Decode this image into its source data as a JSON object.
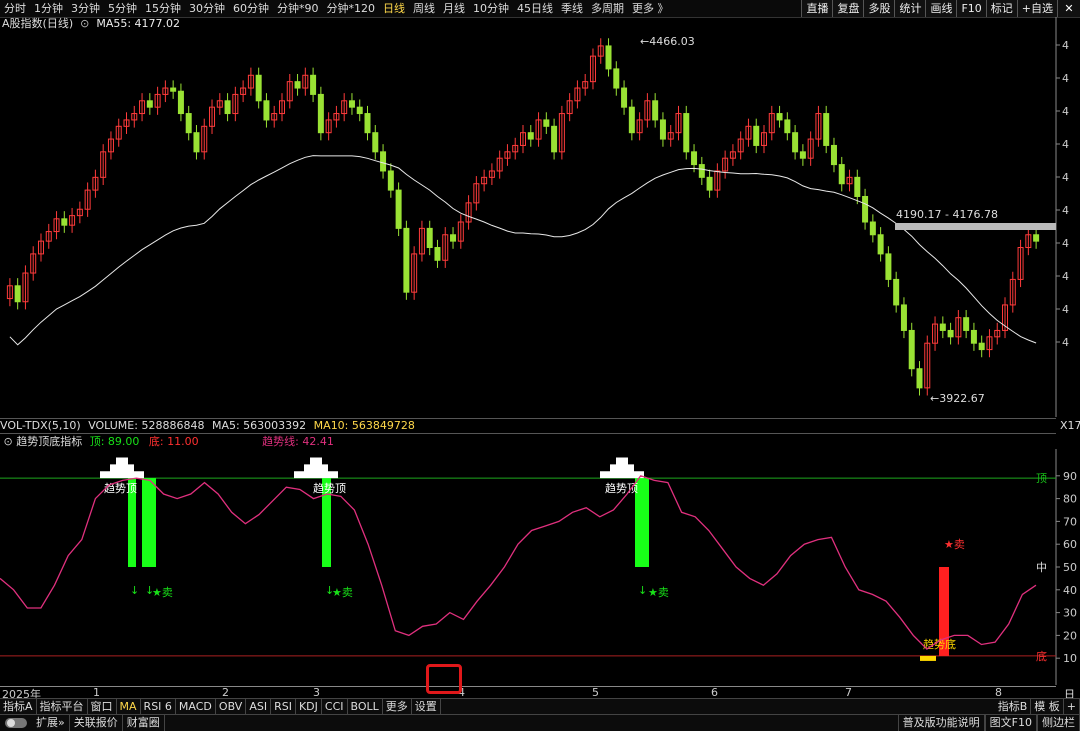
{
  "toolbar": {
    "periods": [
      "分时",
      "1分钟",
      "3分钟",
      "5分钟",
      "15分钟",
      "30分钟",
      "60分钟",
      "分钟*90",
      "分钟*120",
      "日线",
      "周线",
      "月线",
      "10分钟",
      "45日线",
      "季线",
      "多周期",
      "更多 》"
    ],
    "active_period": "日线",
    "right_buttons": [
      "直播",
      "复盘",
      "多股",
      "统计",
      "画线",
      "F10",
      "标记",
      "+自选"
    ],
    "window_controls": [
      "✕"
    ]
  },
  "main_chart": {
    "title": "A股指数(日线)",
    "indicator": "MA55: 4177.02",
    "high_label": "4466.03",
    "low_label": "3922.67",
    "range_label": "4190.17 - 4176.78"
  },
  "volume_header": {
    "name": "VOL-TDX(5,10)",
    "volume": "VOLUME: 528886848",
    "ma5": "MA5: 563003392",
    "ma10": "MA10: 563849728"
  },
  "right_edge_label": "X17",
  "indicator_header": {
    "name": "趋势顶底指标",
    "top": "顶: 89.00",
    "bottom": "底: 11.00",
    "line": "趋势线: 42.41"
  },
  "indicator_labels": {
    "top_marker": "趋势顶",
    "bottom_marker": "趋势底",
    "sell": "卖",
    "right_top": "顶",
    "right_mid": "中",
    "right_bottom": "底"
  },
  "indicator_axis": [
    "90",
    "80",
    "70",
    "60",
    "50",
    "40",
    "30",
    "20",
    "10"
  ],
  "x_axis": {
    "year_label": "2025年",
    "months": [
      "1",
      "2",
      "3",
      "4",
      "5",
      "6",
      "7",
      "8"
    ]
  },
  "x_axis_right": "日",
  "tabs": [
    "指标A",
    "指标平台",
    "窗口",
    "MA",
    "RSI 6",
    "MACD",
    "OBV",
    "ASI",
    "RSI",
    "KDJ",
    "CCI",
    "BOLL",
    "更多",
    "设置"
  ],
  "active_tab": "MA",
  "tabs_right": [
    "指标B",
    "模 板",
    "+"
  ],
  "statusbar": {
    "left": [
      "扩展»",
      "关联报价",
      "财富圈"
    ],
    "right": [
      "普及版功能说明",
      "图文F10",
      "侧边栏"
    ]
  },
  "colors": {
    "up": "#ff3b3b",
    "down": "#9ae234",
    "ma_line": "#e8e8e8",
    "trend_line": "#e0307e",
    "top_bar": "#18ff18",
    "bottom_bar": "#ff2020",
    "guide_line": "#1ea81e",
    "highlight_box": "#e0181a"
  },
  "icons": [
    "close-icon",
    "toggle-icon"
  ],
  "chart_data": {
    "type": "candlestick",
    "title": "A股指数(日线)",
    "annotations": [
      "4466.03",
      "3922.67",
      "4190.17 - 4176.78"
    ],
    "ma55_last": 4177.02,
    "indicator_series": {
      "name": "趋势线",
      "last": 42.41,
      "top_threshold": 89.0,
      "bottom_threshold": 11.0,
      "values": [
        45,
        40,
        32,
        32,
        42,
        55,
        62,
        80,
        86,
        88,
        89,
        88,
        82,
        80,
        82,
        87,
        82,
        74,
        69,
        73,
        79,
        85,
        84,
        80,
        82,
        81,
        75,
        60,
        42,
        22,
        20,
        24,
        25,
        30,
        27,
        35,
        42,
        50,
        60,
        66,
        68,
        70,
        74,
        76,
        72,
        75,
        82,
        90,
        88,
        87,
        74,
        72,
        66,
        58,
        50,
        45,
        42,
        47,
        55,
        60,
        62,
        63,
        50,
        40,
        38,
        35,
        28,
        20,
        14,
        18,
        20,
        20,
        16,
        17,
        25,
        38,
        42
      ]
    },
    "top_signals": [
      "趋势顶",
      "趋势顶",
      "趋势顶"
    ],
    "bottom_signals": [
      "趋势底"
    ]
  }
}
